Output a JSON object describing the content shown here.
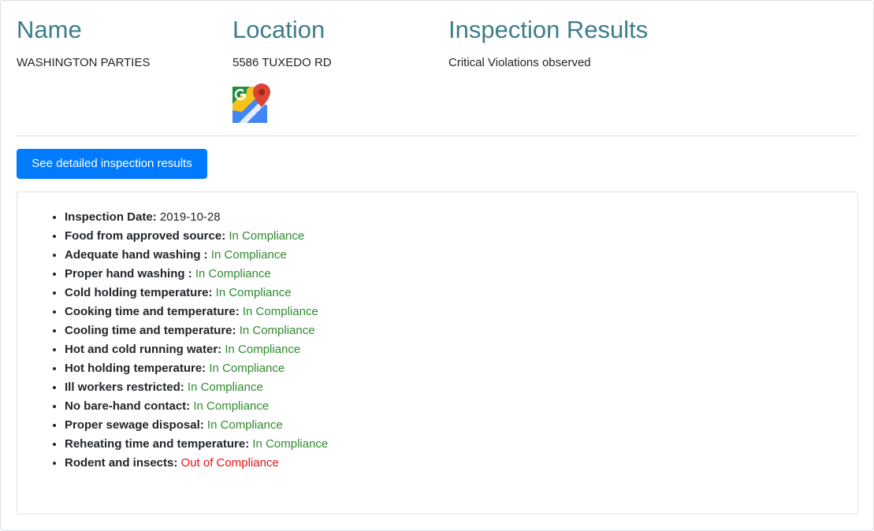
{
  "header": {
    "name_title": "Name",
    "name_value": "WASHINGTON PARTIES",
    "location_title": "Location",
    "location_value": "5586 TUXEDO RD",
    "results_title": "Inspection Results",
    "results_value": "Critical Violations observed",
    "maps_icon": "google-maps-icon"
  },
  "actions": {
    "detail_button_label": "See detailed inspection results"
  },
  "results": {
    "date_label": "Inspection Date:",
    "date_value": "2019-10-28",
    "items": [
      {
        "label": "Food from approved source:",
        "status": "In Compliance"
      },
      {
        "label": "Adequate hand washing :",
        "status": "In Compliance"
      },
      {
        "label": "Proper hand washing :",
        "status": "In Compliance"
      },
      {
        "label": "Cold holding temperature:",
        "status": "In Compliance"
      },
      {
        "label": "Cooking time and temperature:",
        "status": "In Compliance"
      },
      {
        "label": "Cooling time and temperature:",
        "status": "In Compliance"
      },
      {
        "label": "Hot and cold running water:",
        "status": "In Compliance"
      },
      {
        "label": "Hot holding temperature:",
        "status": "In Compliance"
      },
      {
        "label": "Ill workers restricted:",
        "status": "In Compliance"
      },
      {
        "label": "No bare-hand contact:",
        "status": "In Compliance"
      },
      {
        "label": "Proper sewage disposal:",
        "status": "In Compliance"
      },
      {
        "label": "Reheating time and temperature:",
        "status": "In Compliance"
      },
      {
        "label": "Rodent and insects:",
        "status": "Out of Compliance"
      }
    ]
  },
  "colors": {
    "heading": "#3d7d8a",
    "primary_button": "#007bff",
    "compliance_ok": "#2e8b2e",
    "compliance_bad": "#e8111b"
  }
}
